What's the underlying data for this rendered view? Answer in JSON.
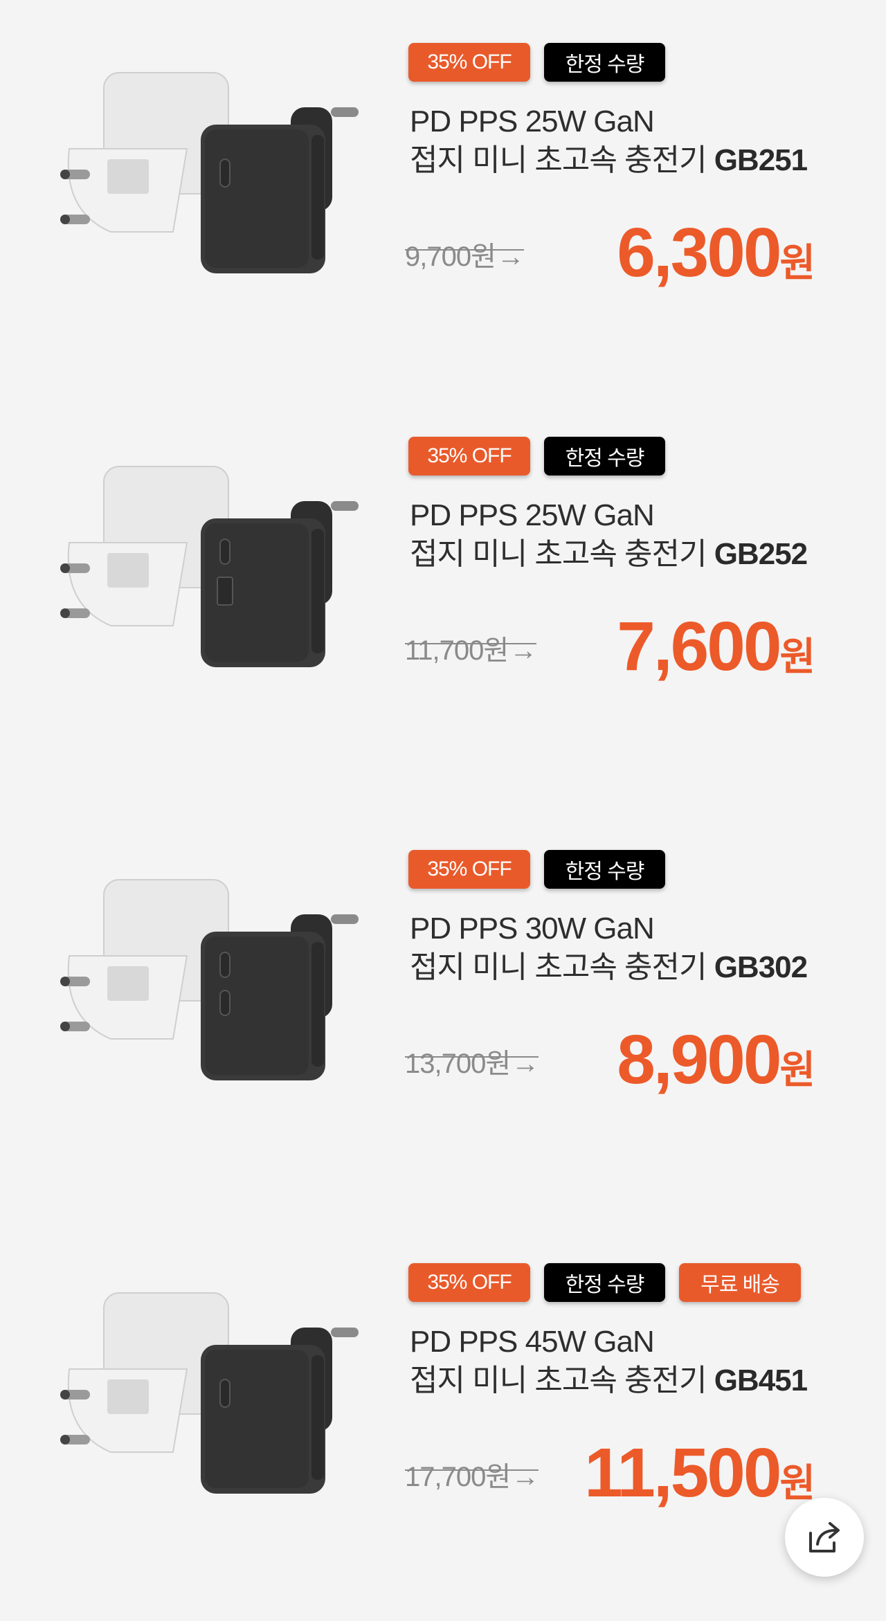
{
  "products": [
    {
      "badges": [
        "35% OFF",
        "한정 수량"
      ],
      "title_line1": "PD PPS 25W GaN",
      "title_line2_prefix": "접지 미니 초고속 충전기 ",
      "model": "GB251",
      "old_price": "9,700원",
      "arrow": "→",
      "new_price": "6,300",
      "currency": "원",
      "ports": [
        "usb-c"
      ]
    },
    {
      "badges": [
        "35% OFF",
        "한정 수량"
      ],
      "title_line1": "PD PPS 25W GaN",
      "title_line2_prefix": "접지 미니 초고속 충전기 ",
      "model": "GB252",
      "old_price": "11,700원",
      "arrow": "→",
      "new_price": "7,600",
      "currency": "원",
      "ports": [
        "usb-c",
        "usb-a"
      ]
    },
    {
      "badges": [
        "35% OFF",
        "한정 수량"
      ],
      "title_line1": "PD PPS 30W GaN",
      "title_line2_prefix": "접지 미니 초고속 충전기 ",
      "model": "GB302",
      "old_price": "13,700원",
      "arrow": "→",
      "new_price": "8,900",
      "currency": "원",
      "ports": [
        "usb-c",
        "usb-c"
      ]
    },
    {
      "badges": [
        "35% OFF",
        "한정 수량",
        "무료 배송"
      ],
      "title_line1": "PD PPS 45W GaN",
      "title_line2_prefix": "접지 미니 초고속 충전기 ",
      "model": "GB451",
      "old_price": "17,700원",
      "arrow": "→",
      "new_price": "11,500",
      "currency": "원",
      "ports": [
        "usb-c"
      ]
    }
  ],
  "colors": {
    "accent": "#ec5a2a",
    "badge_dark": "#000000",
    "background": "#f4f4f4"
  },
  "share_icon": "share-icon"
}
